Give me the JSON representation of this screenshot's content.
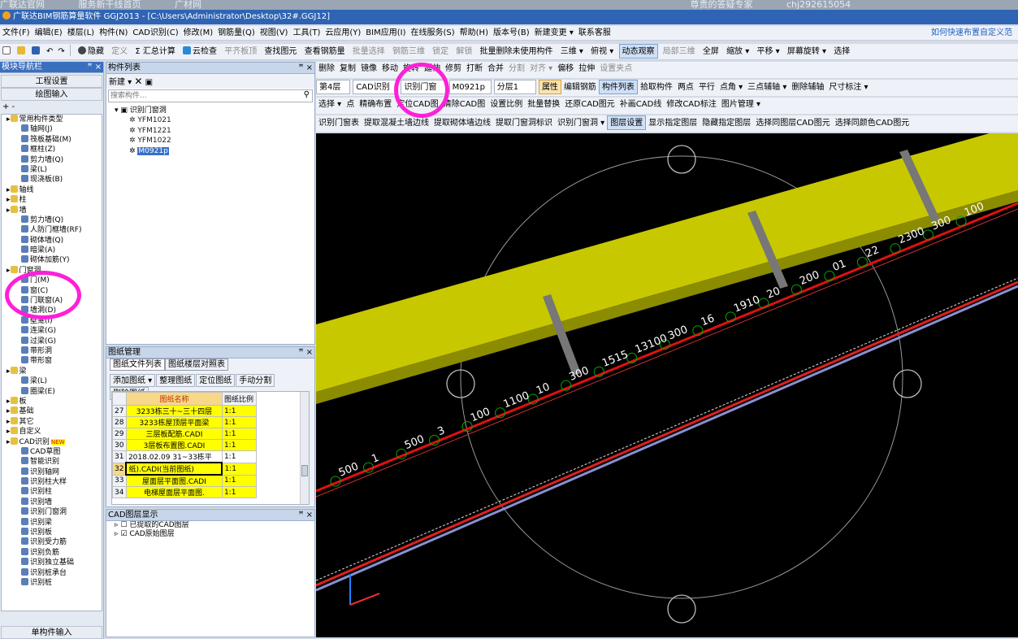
{
  "background_strip": [
    "广联达官网",
    "服务新干线首页",
    "广材网",
    "尊贵的答疑专家",
    "chj292615054"
  ],
  "window": {
    "title": "广联达BIM钢筋算量软件 GGJ2013 - [C:\\Users\\Administrator\\Desktop\\32#.GGJ12]"
  },
  "menu": [
    "文件(F)",
    "编辑(E)",
    "楼层(L)",
    "构件(N)",
    "CAD识别(C)",
    "修改(M)",
    "钢筋量(Q)",
    "视图(V)",
    "工具(T)",
    "云应用(Y)",
    "BIM应用(I)",
    "在线服务(S)",
    "帮助(H)",
    "版本号(B)",
    "新建变更 ▾",
    "联系客服"
  ],
  "menu_help": "如何快速布置自定义范",
  "toolbar1": [
    "隐藏",
    "定义",
    "Σ 汇总计算",
    "云检查",
    "平齐板顶",
    "查找图元",
    "查看钢筋量",
    "批量选择",
    "钢筋三维",
    "锁定",
    "解锁",
    "批量删除未使用构件",
    "三维 ▾",
    "俯视 ▾",
    "动态观察",
    "局部三维",
    "全屏",
    "缩放 ▾",
    "平移 ▾",
    "屏幕旋转 ▾",
    "选择"
  ],
  "toolbar2": [
    "删除",
    "复制",
    "镜像",
    "移动",
    "旋转",
    "延伸",
    "修剪",
    "打断",
    "合并",
    "分割",
    "对齐 ▾",
    "偏移",
    "拉伸",
    "设置夹点"
  ],
  "toolbar3": {
    "floor": "第4层",
    "mode": "CAD识别",
    "type": "识别门窗",
    "comp": "M0921p",
    "layer": "分层1",
    "buttons": [
      "属性",
      "编辑钢筋",
      "构件列表",
      "拾取构件",
      "两点",
      "平行",
      "点角 ▾",
      "三点辅轴 ▾",
      "删除辅轴",
      "尺寸标注 ▾"
    ]
  },
  "toolbar4": [
    "选择 ▾",
    "点",
    "精确布置",
    "定位CAD图",
    "清除CAD图",
    "设置比例",
    "批量替换",
    "还原CAD图元",
    "补画CAD线",
    "修改CAD标注",
    "图片管理 ▾"
  ],
  "toolbar5": [
    "识别门窗表",
    "提取混凝土墙边线",
    "提取砌体墙边线",
    "提取门窗洞标识",
    "识别门窗洞 ▾",
    "图层设置",
    "显示指定图层",
    "隐藏指定图层",
    "选择同图层CAD图元",
    "选择同颜色CAD图元"
  ],
  "nav": {
    "title": "模块导航栏",
    "buttons": [
      "工程设置",
      "绘图输入"
    ],
    "tree": [
      {
        "label": "常用构件类型",
        "level": 0,
        "folder": true
      },
      {
        "label": "轴网(J)",
        "level": 1
      },
      {
        "label": "筏板基础(M)",
        "level": 1
      },
      {
        "label": "框柱(Z)",
        "level": 1
      },
      {
        "label": "剪力墙(Q)",
        "level": 1
      },
      {
        "label": "梁(L)",
        "level": 1
      },
      {
        "label": "现浇板(B)",
        "level": 1
      },
      {
        "label": "轴线",
        "level": 0,
        "folder": true
      },
      {
        "label": "柱",
        "level": 0,
        "folder": true
      },
      {
        "label": "墙",
        "level": 0,
        "folder": true
      },
      {
        "label": "剪力墙(Q)",
        "level": 1
      },
      {
        "label": "人防门框墙(RF)",
        "level": 1
      },
      {
        "label": "砌体墙(Q)",
        "level": 1
      },
      {
        "label": "暗梁(A)",
        "level": 1
      },
      {
        "label": "砌体加筋(Y)",
        "level": 1
      },
      {
        "label": "门窗洞",
        "level": 0,
        "folder": true
      },
      {
        "label": "门(M)",
        "level": 1
      },
      {
        "label": "窗(C)",
        "level": 1
      },
      {
        "label": "门联窗(A)",
        "level": 1
      },
      {
        "label": "墙洞(D)",
        "level": 1
      },
      {
        "label": "壁龛(I)",
        "level": 1
      },
      {
        "label": "连梁(G)",
        "level": 1
      },
      {
        "label": "过梁(G)",
        "level": 1
      },
      {
        "label": "带形洞",
        "level": 1
      },
      {
        "label": "带形窗",
        "level": 1
      },
      {
        "label": "梁",
        "level": 0,
        "folder": true
      },
      {
        "label": "梁(L)",
        "level": 1
      },
      {
        "label": "圈梁(E)",
        "level": 1
      },
      {
        "label": "板",
        "level": 0,
        "folder": true
      },
      {
        "label": "基础",
        "level": 0,
        "folder": true
      },
      {
        "label": "其它",
        "level": 0,
        "folder": true
      },
      {
        "label": "自定义",
        "level": 0,
        "folder": true
      },
      {
        "label": "CAD识别",
        "level": 0,
        "folder": true,
        "badge": "NEW"
      },
      {
        "label": "CAD草图",
        "level": 1
      },
      {
        "label": "智能识别",
        "level": 1
      },
      {
        "label": "识别轴网",
        "level": 1
      },
      {
        "label": "识别柱大样",
        "level": 1
      },
      {
        "label": "识别柱",
        "level": 1
      },
      {
        "label": "识别墙",
        "level": 1
      },
      {
        "label": "识别门窗洞",
        "level": 1
      },
      {
        "label": "识别梁",
        "level": 1
      },
      {
        "label": "识别板",
        "level": 1
      },
      {
        "label": "识别受力筋",
        "level": 1
      },
      {
        "label": "识别负筋",
        "level": 1
      },
      {
        "label": "识别独立基础",
        "level": 1
      },
      {
        "label": "识别桩承台",
        "level": 1
      },
      {
        "label": "识别桩",
        "level": 1
      }
    ],
    "bottom_button": "单构件输入"
  },
  "complist": {
    "title": "构件列表",
    "new_label": "新建 ▾",
    "search_placeholder": "搜索构件...",
    "root": "识别门窗洞",
    "items": [
      "YFM1021",
      "YFM1221",
      "YFM1022",
      "M0921p"
    ]
  },
  "drawing": {
    "title": "图纸管理",
    "tabs": [
      "图纸文件列表",
      "图纸楼层对照表"
    ],
    "buttons": [
      "添加图纸 ▾",
      "整理图纸",
      "定位图纸",
      "手动分割",
      "删除图纸"
    ],
    "headers": [
      "图纸名称",
      "图纸比例"
    ],
    "rows": [
      {
        "n": "27",
        "name": "3233栋三十~三十四层",
        "scale": "1:1"
      },
      {
        "n": "28",
        "name": "3233栋屋顶层平面梁",
        "scale": "1:1"
      },
      {
        "n": "29",
        "name": "三层板配筋.CADI",
        "scale": "1:1"
      },
      {
        "n": "30",
        "name": "3层板布置图.CADI",
        "scale": "1:1"
      },
      {
        "n": "31",
        "name": "2018.02.09 31~33栋平",
        "scale": "1:1"
      },
      {
        "n": "32",
        "name": "纸).CADI(当前图纸)",
        "scale": "1:1"
      },
      {
        "n": "33",
        "name": "屋面层平面图.CADI",
        "scale": "1:1"
      },
      {
        "n": "34",
        "name": "电梯屋面层平面图.",
        "scale": "1:1"
      }
    ]
  },
  "layers": {
    "title": "CAD图层显示",
    "items": [
      "已提取的CAD图层",
      "CAD原始图层"
    ]
  },
  "canvas": {
    "labels": [
      "100",
      "300",
      "2300",
      "22",
      "01",
      "200",
      "20",
      "1910",
      "16",
      "300",
      "13100",
      "1515",
      "300",
      "10",
      "1100",
      "100",
      "3",
      "500",
      "1",
      "500"
    ]
  },
  "colors": {
    "accent": "#2f64b4",
    "highlight": "#ff1fd8",
    "beam": "#c8c800"
  }
}
